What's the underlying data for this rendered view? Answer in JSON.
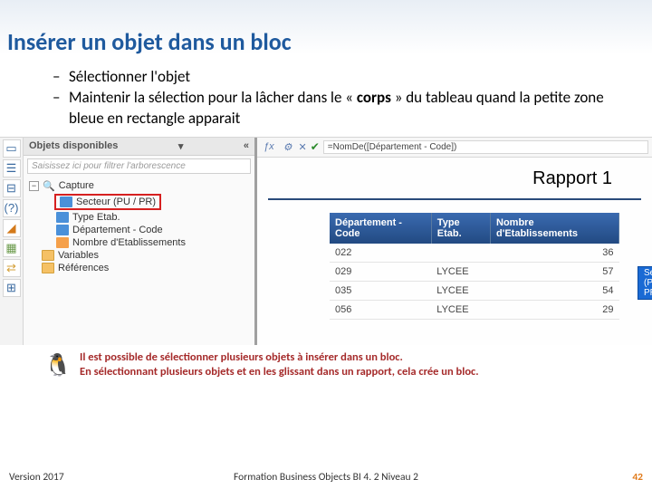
{
  "title": "Insérer un objet dans un bloc",
  "bullets": {
    "b1": "Sélectionner l'objet",
    "b2_pre": "Maintenir la sélection pour la lâcher dans le « ",
    "b2_bold": "corps",
    "b2_post": " » du tableau quand la petite zone bleue en rectangle apparait"
  },
  "panel": {
    "title": "Objets disponibles",
    "filter_placeholder": "Saisissez ici pour filtrer l'arborescence",
    "root": "Capture",
    "items": {
      "secteur": "Secteur (PU / PR)",
      "type_etab": "Type Etab.",
      "dept_code": "Département - Code",
      "nb_etab": "Nombre d'Etablissements"
    },
    "variables": "Variables",
    "references": "Références"
  },
  "formula": "=NomDe([Département - Code])",
  "report": {
    "title": "Rapport 1",
    "cols": {
      "c1": "Département - Code",
      "c2": "Type Etab.",
      "c3": "Nombre d'Etablissements"
    },
    "rows": [
      {
        "code": "022",
        "type": "",
        "nb": "36"
      },
      {
        "code": "029",
        "type": "LYCEE",
        "nb": "57"
      },
      {
        "code": "035",
        "type": "LYCEE",
        "nb": "54"
      },
      {
        "code": "056",
        "type": "LYCEE",
        "nb": "29"
      }
    ],
    "drag_chip": "Secteur (PU / PR)"
  },
  "tip": {
    "line1": "Il est possible de sélectionner plusieurs objets à insérer dans un bloc.",
    "line2": "En sélectionnant plusieurs objets et en les glissant dans un rapport, cela crée un bloc."
  },
  "footer": {
    "left": "Version 2017",
    "center": "Formation Business Objects BI 4. 2 Niveau 2",
    "page": "42"
  }
}
